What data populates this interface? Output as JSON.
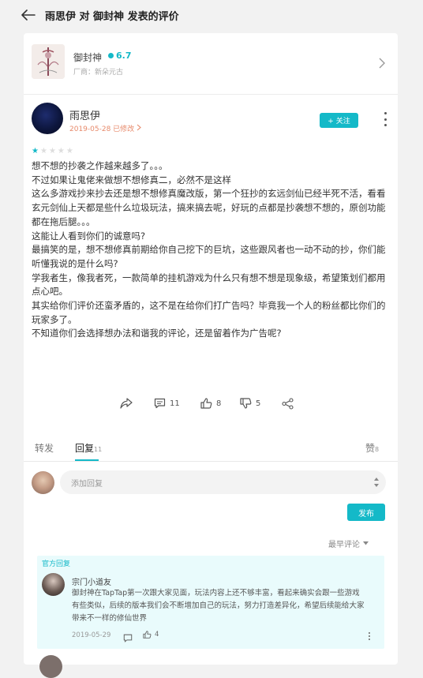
{
  "header": {
    "title": "雨思伊 对 御封神 发表的评价"
  },
  "game": {
    "name": "御封神",
    "rating": "6.7",
    "vendor": "厂商：新朵元古"
  },
  "author": {
    "name": "雨思伊",
    "date_line": "2019-05-28 已修改 ",
    "follow_label": "+ 关注"
  },
  "review": {
    "stars": 1,
    "max_stars": 5,
    "paragraphs": [
      "想不想的抄袭之作越来越多了。。。",
      "不过如果让鬼佬来做想不想修真二，必然不是这样",
      "这么多游戏抄来抄去还是想不想修真魔改版，第一个狂抄的玄远剑仙已经半死不活，看看玄元剑仙上天都是些什么垃圾玩法，搞来搞去呢，好玩的点都是抄袭想不想的，原创功能都在拖后腿。。。",
      "这能让人看到你们的诚意吗?",
      "最搞笑的是，想不想修真前期给你自己挖下的巨坑，这些跟风者也一动不动的抄，你们能听懂我说的是什么吗?",
      "学我者生，像我者死，一款简单的挂机游戏为什么只有想不想是现象级，希望策划们都用点心吧。",
      "其实给你们评价还蛮矛盾的，这不是在给你们打广告吗？毕竟我一个人的粉丝都比你们的玩家多了。",
      "不知道你们会选择想办法和谐我的评论，还是留着作为广告呢?"
    ]
  },
  "actions": {
    "comments": "11",
    "likes": "8",
    "dislikes": "5"
  },
  "tabs": {
    "repost": "转发",
    "reply": "回复",
    "reply_count": "11",
    "likes": "赞",
    "likes_count": "8"
  },
  "reply_box": {
    "placeholder": "添加回复",
    "publish": "发布"
  },
  "sort": {
    "label": "最早评论"
  },
  "official_reply": {
    "label": "官方回复",
    "name": "宗门小道友",
    "text": "御封神在TapTap第一次跟大家见面，玩法内容上还不够丰富，看起来确实会跟一些游戏有些类似，后续的版本我们会不断增加自己的玩法，努力打造差异化，希望后续能给大家带来不一样的修仙世界",
    "date": "2019-05-29",
    "likes": "4"
  },
  "colors": {
    "accent": "#14b9c8",
    "date_orange": "#e78a6b"
  }
}
